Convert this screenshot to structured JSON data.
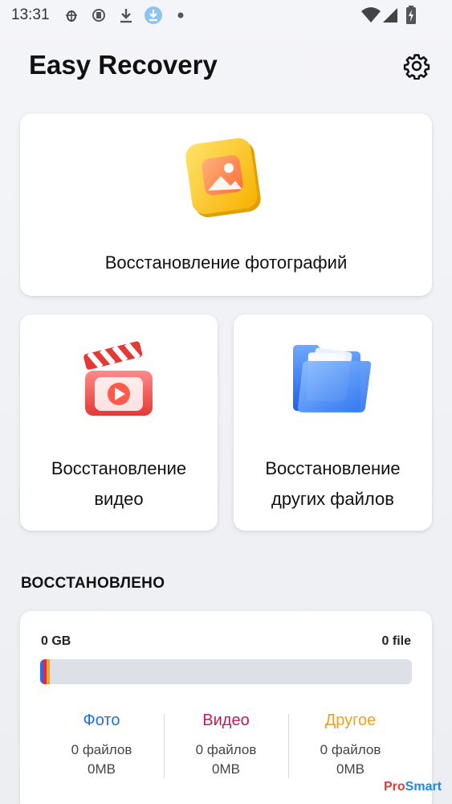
{
  "status_bar": {
    "time": "13:31",
    "icons": [
      "bug-icon",
      "sync-icon",
      "download-icon",
      "app-download-icon",
      "dot-icon",
      "wifi-icon",
      "signal-icon",
      "battery-icon"
    ]
  },
  "header": {
    "title": "Easy Recovery",
    "settings_icon": "gear-icon"
  },
  "cards": {
    "photo": {
      "label": "Восстановление фотографий",
      "icon": "photo-icon"
    },
    "video": {
      "line1": "Восстановление",
      "line2": "видео",
      "icon": "video-clapper-icon"
    },
    "other": {
      "line1": "Восстановление",
      "line2": "других файлов",
      "icon": "folder-icon"
    }
  },
  "recovered": {
    "section_title": "ВОССТАНОВЛЕНО",
    "storage": "0 GB",
    "files": "0 file",
    "bar_segments": [
      {
        "color": "#1e6fe8",
        "fraction": 0.009
      },
      {
        "color": "#e0245e",
        "fraction": 0.009
      },
      {
        "color": "#f7a21b",
        "fraction": 0.009
      }
    ],
    "stats": [
      {
        "title": "Фото",
        "count": "0 файлов",
        "size": "0MB",
        "color": "#1e6fe8"
      },
      {
        "title": "Видео",
        "count": "0 файлов",
        "size": "0MB",
        "color": "#c2185b"
      },
      {
        "title": "Другое",
        "count": "0 файлов",
        "size": "0MB",
        "color": "#f5a01a"
      }
    ]
  },
  "watermark": {
    "pro": "Pro",
    "smart": "Smart"
  }
}
